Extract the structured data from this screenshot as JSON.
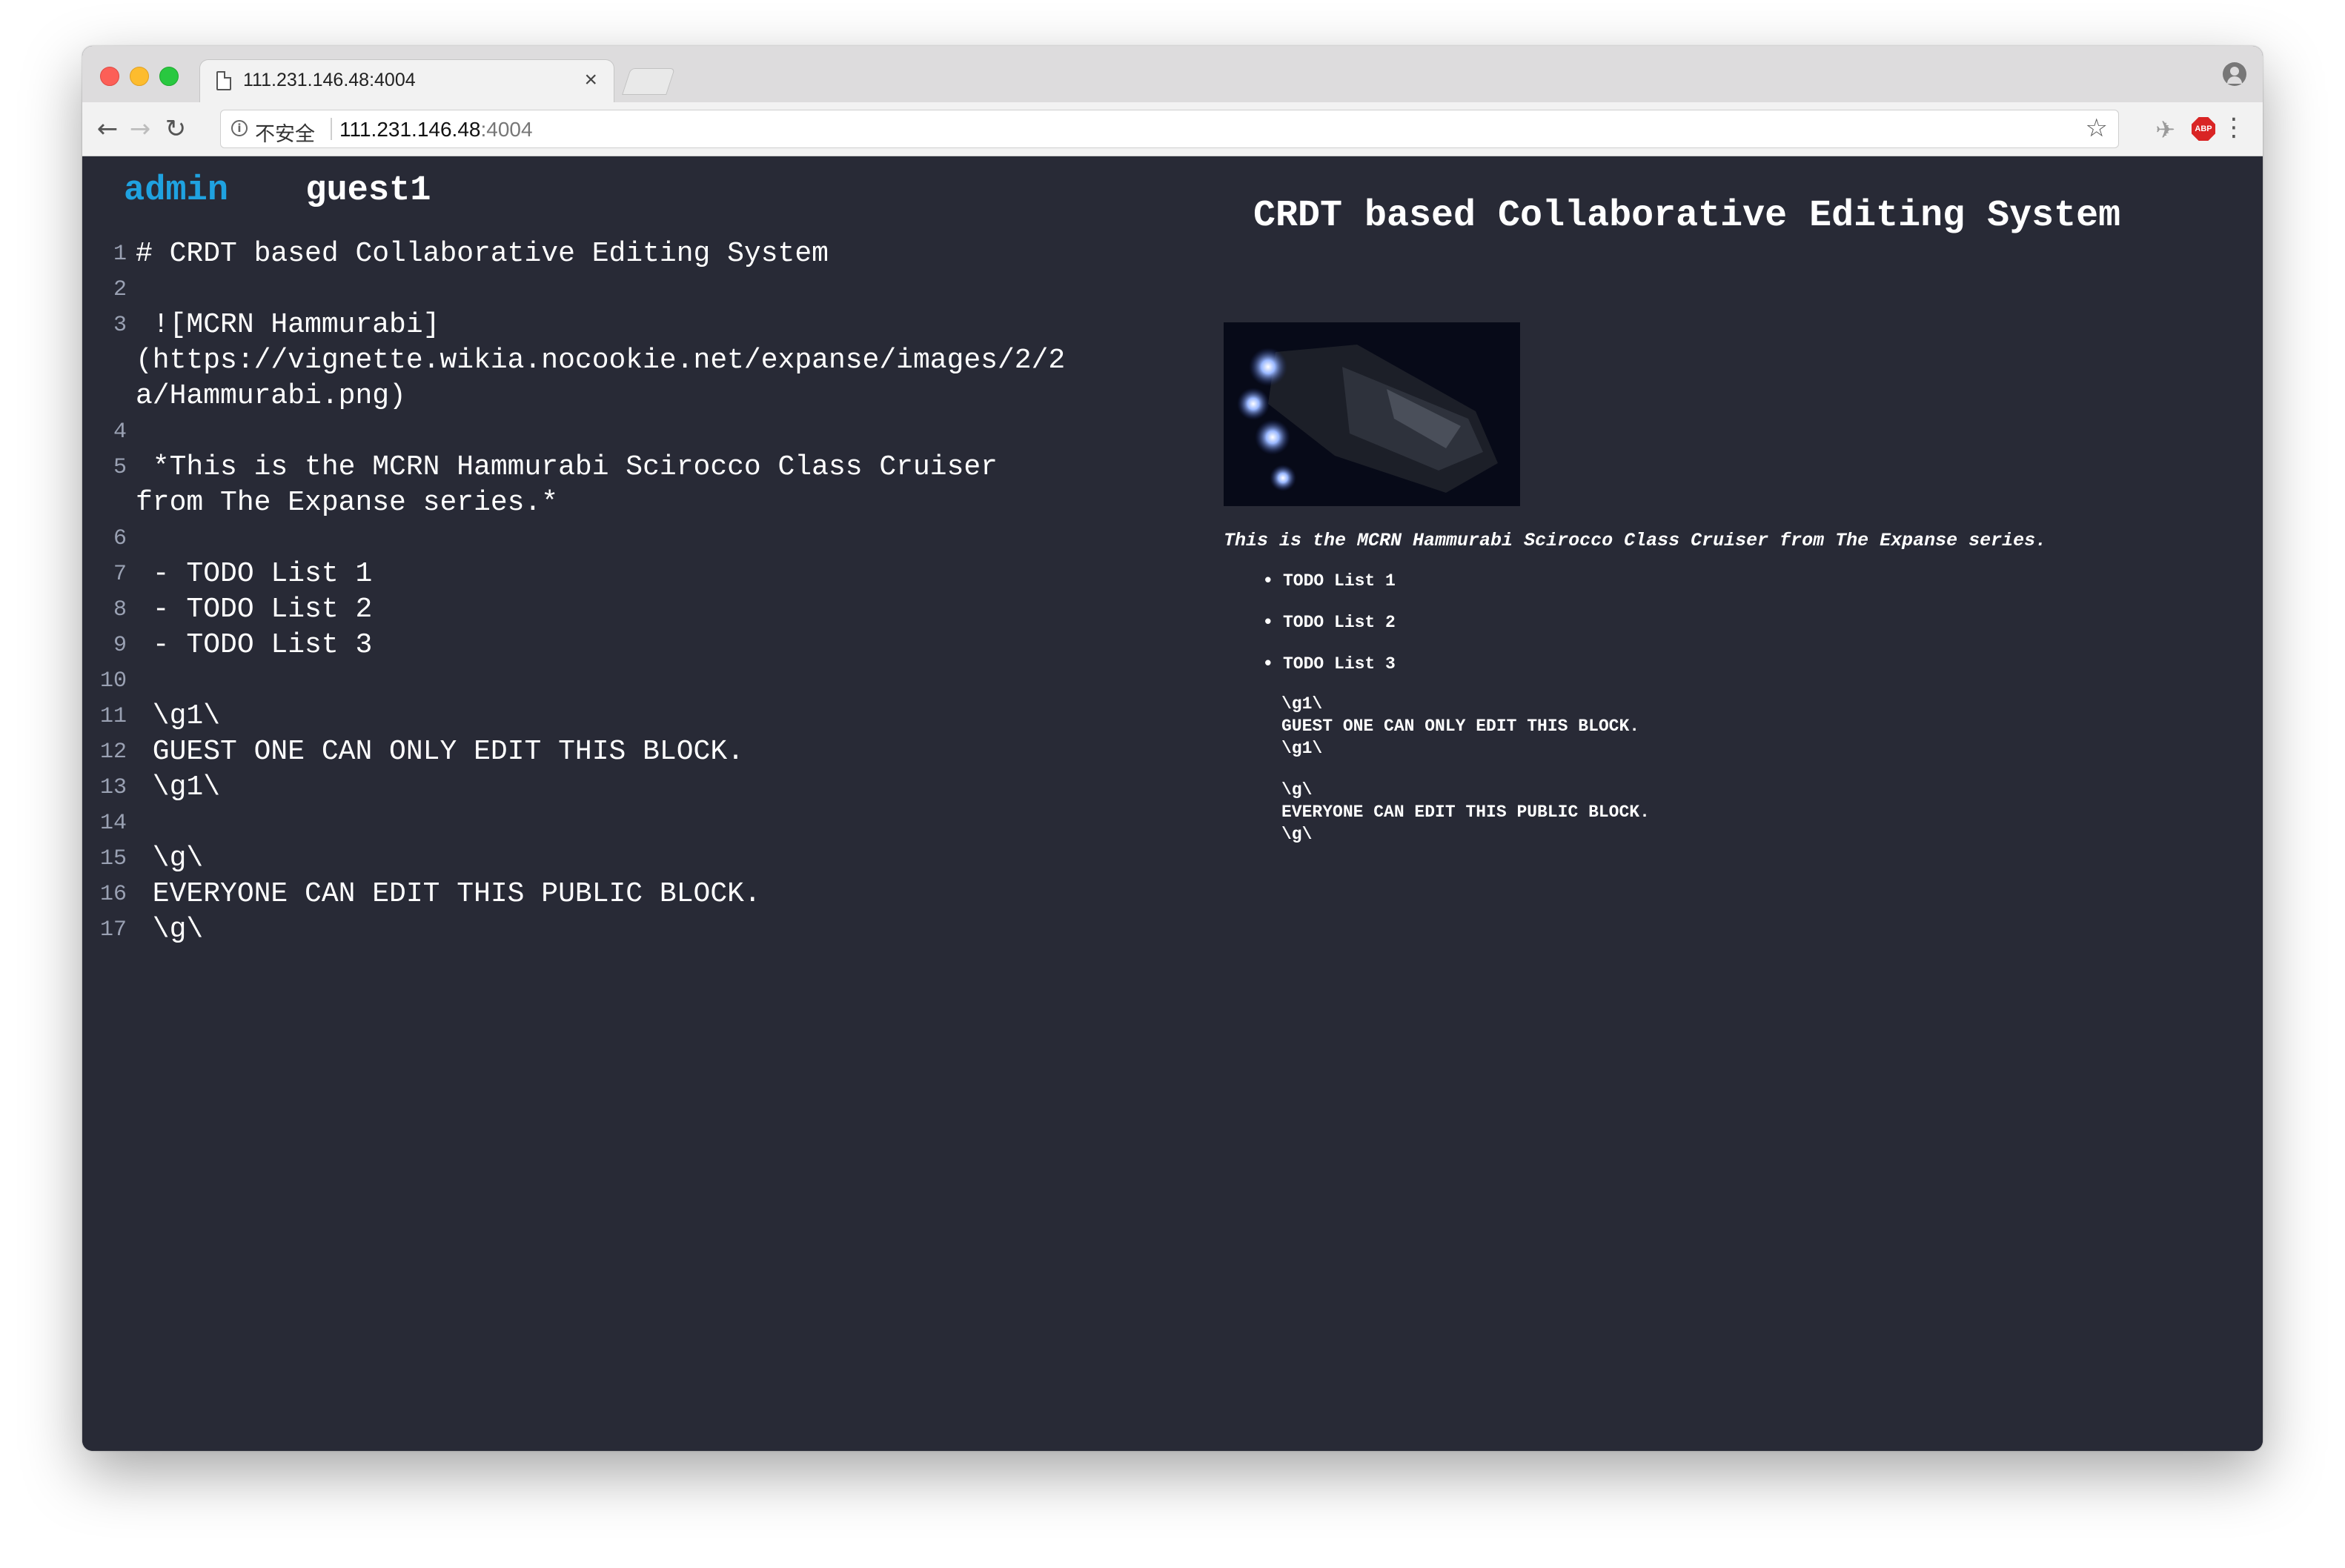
{
  "browser": {
    "tab_title": "111.231.146.48:4004",
    "tab_close": "×",
    "not_secure_label": "不安全",
    "url_host": "111.231.146.48",
    "url_port": ":4004",
    "icons": [
      "back-arrow-icon",
      "forward-arrow-icon",
      "reload-icon",
      "info-icon",
      "star-icon",
      "extension-feather-icon",
      "adblock-icon",
      "menu-dots-icon",
      "profile-icon"
    ],
    "abp_label": "ABP"
  },
  "header": {
    "users": [
      "admin",
      "guest1"
    ],
    "active_user_color": "#1fa2e0"
  },
  "editor": {
    "lines": [
      {
        "n": "1",
        "text": "# CRDT based Collaborative Editing System"
      },
      {
        "n": "2",
        "text": ""
      },
      {
        "n": "3",
        "text": " ![MCRN Hammurabi]"
      },
      {
        "n": "",
        "text": "(https://vignette.wikia.nocookie.net/expanse/images/2/2"
      },
      {
        "n": "",
        "text": "a/Hammurabi.png)"
      },
      {
        "n": "4",
        "text": ""
      },
      {
        "n": "5",
        "text": " *This is the MCRN Hammurabi Scirocco Class Cruiser"
      },
      {
        "n": "",
        "text": "from The Expanse series.*"
      },
      {
        "n": "6",
        "text": ""
      },
      {
        "n": "7",
        "text": " - TODO List 1"
      },
      {
        "n": "8",
        "text": " - TODO List 2"
      },
      {
        "n": "9",
        "text": " - TODO List 3"
      },
      {
        "n": "10",
        "text": ""
      },
      {
        "n": "11",
        "text": " \\g1\\"
      },
      {
        "n": "12",
        "text": " GUEST ONE CAN ONLY EDIT THIS BLOCK."
      },
      {
        "n": "13",
        "text": " \\g1\\"
      },
      {
        "n": "14",
        "text": ""
      },
      {
        "n": "15",
        "text": " \\g\\"
      },
      {
        "n": "16",
        "text": " EVERYONE CAN EDIT THIS PUBLIC BLOCK."
      },
      {
        "n": "17",
        "text": " \\g\\"
      }
    ]
  },
  "preview": {
    "title": "CRDT based Collaborative Editing System",
    "image_alt": "MCRN Hammurabi",
    "caption": "This is the MCRN Hammurabi Scirocco Class Cruiser from The Expanse series.",
    "todo": [
      "TODO List 1",
      "TODO List 2",
      "TODO List 3"
    ],
    "block_guest": "\\g1\\\nGUEST ONE CAN ONLY EDIT THIS BLOCK.\n\\g1\\",
    "block_public": "\\g\\\nEVERYONE CAN EDIT THIS PUBLIC BLOCK.\n\\g\\"
  }
}
